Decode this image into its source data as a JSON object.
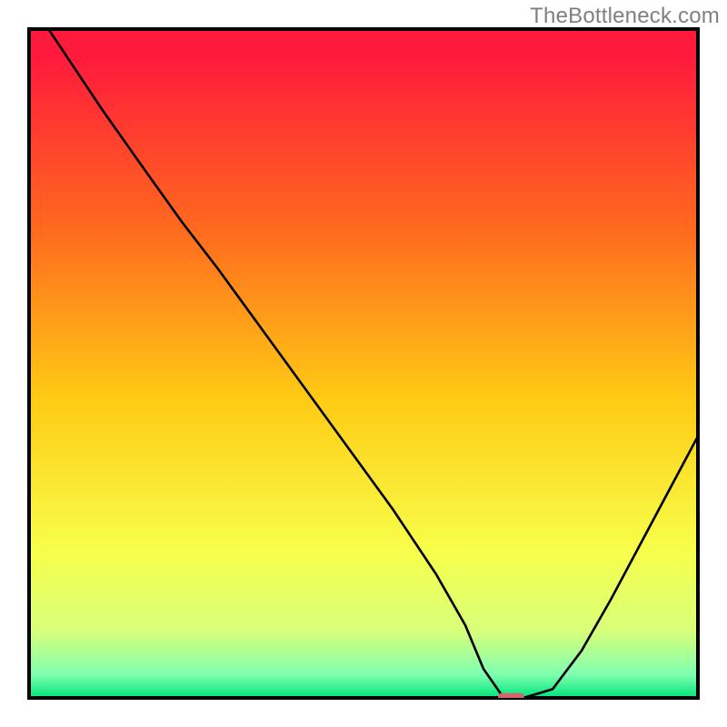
{
  "watermark": "TheBottleneck.com",
  "chart_data": {
    "type": "line",
    "title": "",
    "xlabel": "",
    "ylabel": "",
    "xlim": [
      0,
      100
    ],
    "ylim": [
      0,
      100
    ],
    "background_gradient": {
      "stops": [
        {
          "offset": 0.0,
          "color": "#ff1a3c"
        },
        {
          "offset": 0.04,
          "color": "#ff1a3c"
        },
        {
          "offset": 0.3,
          "color": "#ff6a1e"
        },
        {
          "offset": 0.55,
          "color": "#ffca14"
        },
        {
          "offset": 0.78,
          "color": "#f7ff4a"
        },
        {
          "offset": 0.9,
          "color": "#d8ff7a"
        },
        {
          "offset": 0.965,
          "color": "#7fffb0"
        },
        {
          "offset": 1.0,
          "color": "#00e47a"
        }
      ]
    },
    "frame": {
      "x": 4.0,
      "y": 4.0,
      "width": 92.0,
      "height": 92.0,
      "stroke": "#000000",
      "stroke_width": 0.5
    },
    "series": [
      {
        "name": "bottleneck-curve",
        "stroke": "#000000",
        "stroke_width": 0.33,
        "x": [
          4.0,
          8.0,
          14.0,
          20.0,
          25.0,
          30.0,
          38.0,
          46.0,
          54.0,
          60.0,
          64.0,
          66.5,
          69.0,
          72.0,
          76.0,
          80.0,
          84.0,
          88.0,
          92.0,
          96.0
        ],
        "y": [
          100.0,
          94.0,
          85.0,
          76.5,
          69.5,
          63.0,
          52.0,
          41.0,
          30.0,
          21.0,
          14.0,
          8.0,
          4.4,
          4.0,
          5.2,
          10.5,
          17.5,
          25.0,
          32.5,
          40.0
        ]
      }
    ],
    "marker": {
      "name": "optimum-marker",
      "x": 70.3,
      "y": 4.15,
      "width": 3.6,
      "height": 1.0,
      "rx": 0.5,
      "fill": "#d9636a"
    }
  }
}
